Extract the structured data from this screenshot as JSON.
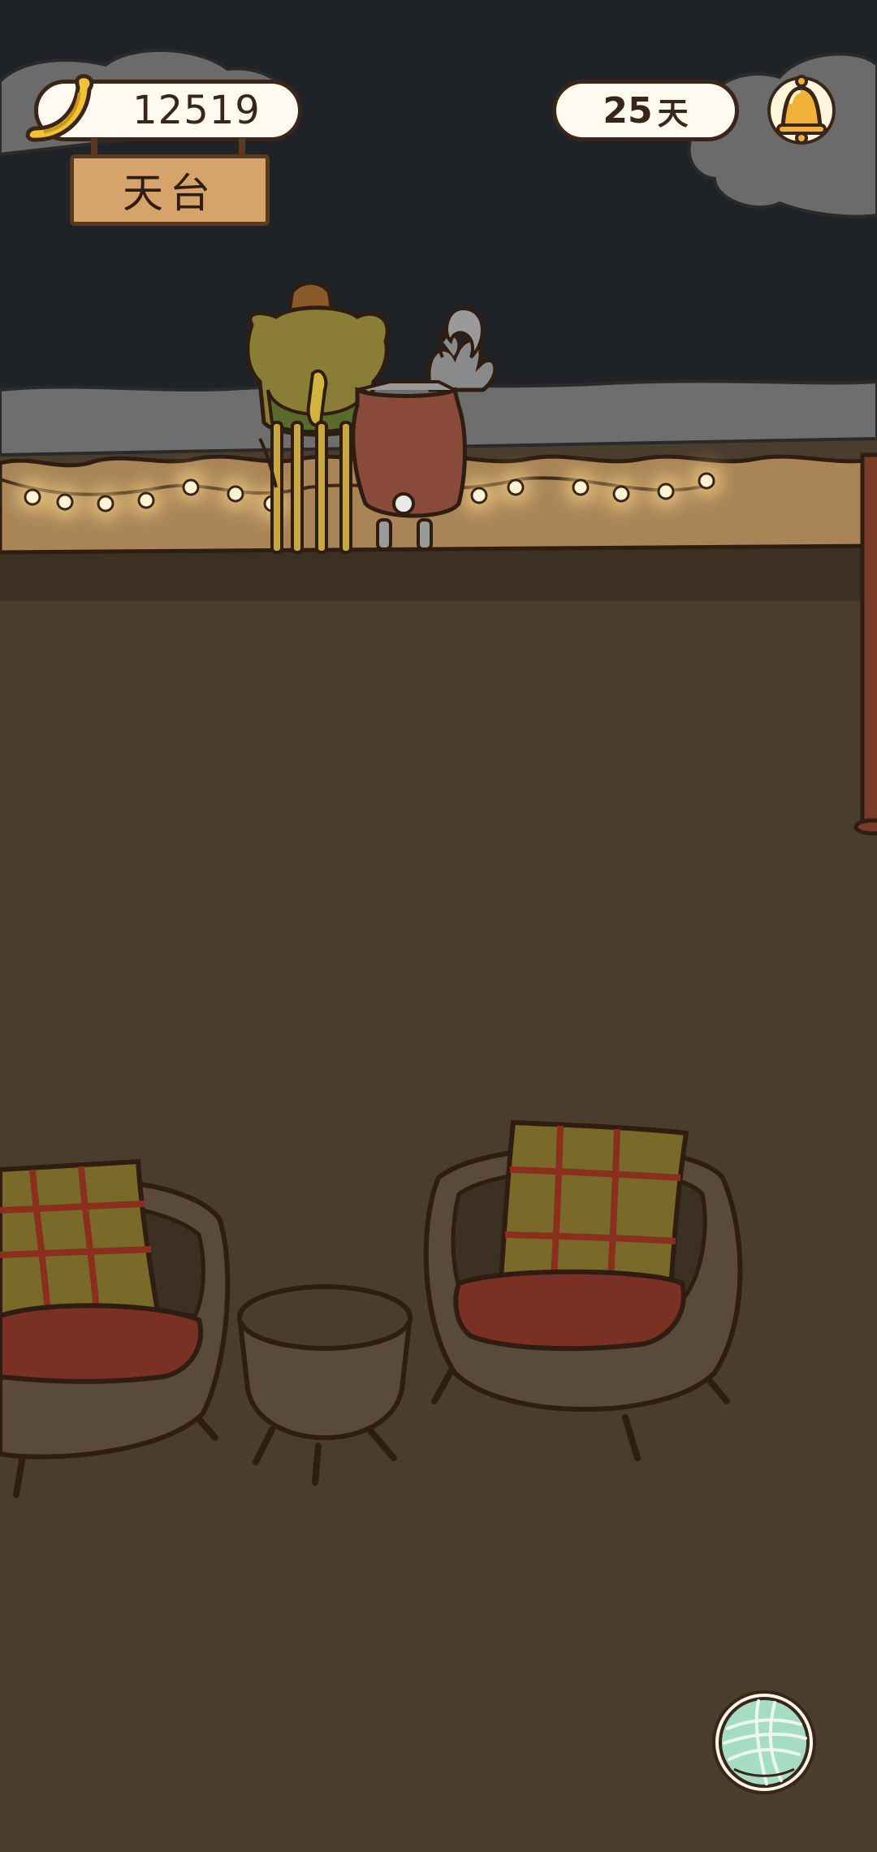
{
  "hud": {
    "coins": "12519",
    "coin_icon": "banana-icon",
    "days_value": "25",
    "days_unit": "天",
    "notification_icon": "bell-icon"
  },
  "location": {
    "name": "天台"
  },
  "bottom_action": {
    "icon": "yarn-ball-icon"
  },
  "colors": {
    "sky": "#1f2226",
    "cloud": "#6b6b6b",
    "floor": "#4b3d2d",
    "wall": "#a88457",
    "pill_bg": "#fffaf0",
    "outline": "#3a2618",
    "sign_wood": "#d6a36a",
    "bell": "#f0b338",
    "yarn": "#a7dcc4"
  }
}
